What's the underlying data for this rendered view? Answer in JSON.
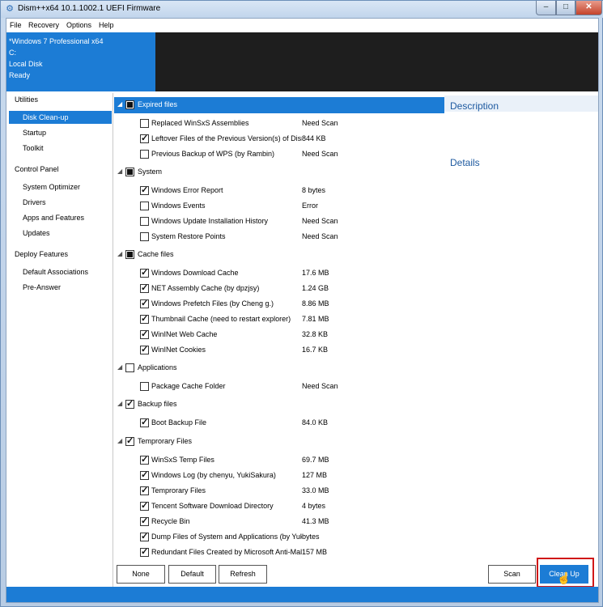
{
  "window": {
    "title": "Dism++x64 10.1.1002.1 UEFI Firmware",
    "controls": {
      "minimize": "–",
      "maximize": "□",
      "close": "✕"
    }
  },
  "menu": [
    "File",
    "Recovery",
    "Options",
    "Help"
  ],
  "info": {
    "os": "*Windows 7 Professional x64",
    "drive": "C:",
    "disk": "Local Disk",
    "status": "Ready"
  },
  "sidebar": {
    "utilities": "Utilities",
    "disk_cleanup": "Disk Clean-up",
    "startup": "Startup",
    "toolkit": "Toolkit",
    "control_panel": "Control Panel",
    "system_optimizer": "System Optimizer",
    "drivers": "Drivers",
    "apps_features": "Apps and Features",
    "updates": "Updates",
    "deploy_features": "Deploy Features",
    "default_associations": "Default Associations",
    "pre_answer": "Pre-Answer"
  },
  "groups": {
    "expired": {
      "label": "Expired files",
      "items": [
        {
          "label": "Replaced WinSxS Assemblies",
          "size": "Need Scan"
        },
        {
          "label": "Leftover Files of the Previous Version(s) of Dism++",
          "size": "844 KB"
        },
        {
          "label": "Previous Backup of WPS (by Rambin)",
          "size": "Need Scan"
        }
      ]
    },
    "system": {
      "label": "System",
      "items": [
        {
          "label": "Windows Error Report",
          "size": "8 bytes"
        },
        {
          "label": "Windows Events",
          "size": "Error"
        },
        {
          "label": "Windows Update Installation History",
          "size": "Need Scan"
        },
        {
          "label": "System Restore Points",
          "size": "Need Scan"
        }
      ]
    },
    "cache": {
      "label": "Cache files",
      "items": [
        {
          "label": "Windows Download Cache",
          "size": "17.6 MB"
        },
        {
          "label": "NET Assembly Cache (by dpzjsy)",
          "size": "1.24 GB"
        },
        {
          "label": "Windows Prefetch Files (by Cheng g.)",
          "size": "8.86 MB"
        },
        {
          "label": "Thumbnail Cache (need to restart explorer)",
          "size": "7.81 MB"
        },
        {
          "label": "WinINet Web Cache",
          "size": "32.8 KB"
        },
        {
          "label": "WinINet Cookies",
          "size": "16.7 KB"
        }
      ]
    },
    "applications": {
      "label": "Applications",
      "items": [
        {
          "label": "Package Cache Folder",
          "size": "Need Scan"
        }
      ]
    },
    "backup": {
      "label": "Backup files",
      "items": [
        {
          "label": "Boot Backup File",
          "size": "84.0 KB"
        }
      ]
    },
    "temporary": {
      "label": "Temprorary Files",
      "items": [
        {
          "label": "WinSxS Temp Files",
          "size": "69.7 MB"
        },
        {
          "label": "Windows Log (by chenyu, YukiSakura)",
          "size": "127 MB"
        },
        {
          "label": "Temprorary Files",
          "size": "33.0 MB"
        },
        {
          "label": "Tencent Software Download Directory",
          "size": "4 bytes"
        },
        {
          "label": "Recycle Bin",
          "size": "41.3 MB"
        },
        {
          "label": "Dump Files of System and Applications (by Yuk8",
          "size": "bytes"
        },
        {
          "label": "Redundant Files Created by Microsoft Anti-Malware",
          "size": "157 MB"
        }
      ]
    }
  },
  "description": {
    "title": "Description",
    "details": "Details"
  },
  "buttons": {
    "none": "None",
    "default": "Default",
    "refresh": "Refresh",
    "scan": "Scan",
    "clean_up": "Clean Up"
  },
  "colors": {
    "accent": "#1c7cd5",
    "highlight": "#d01818"
  }
}
